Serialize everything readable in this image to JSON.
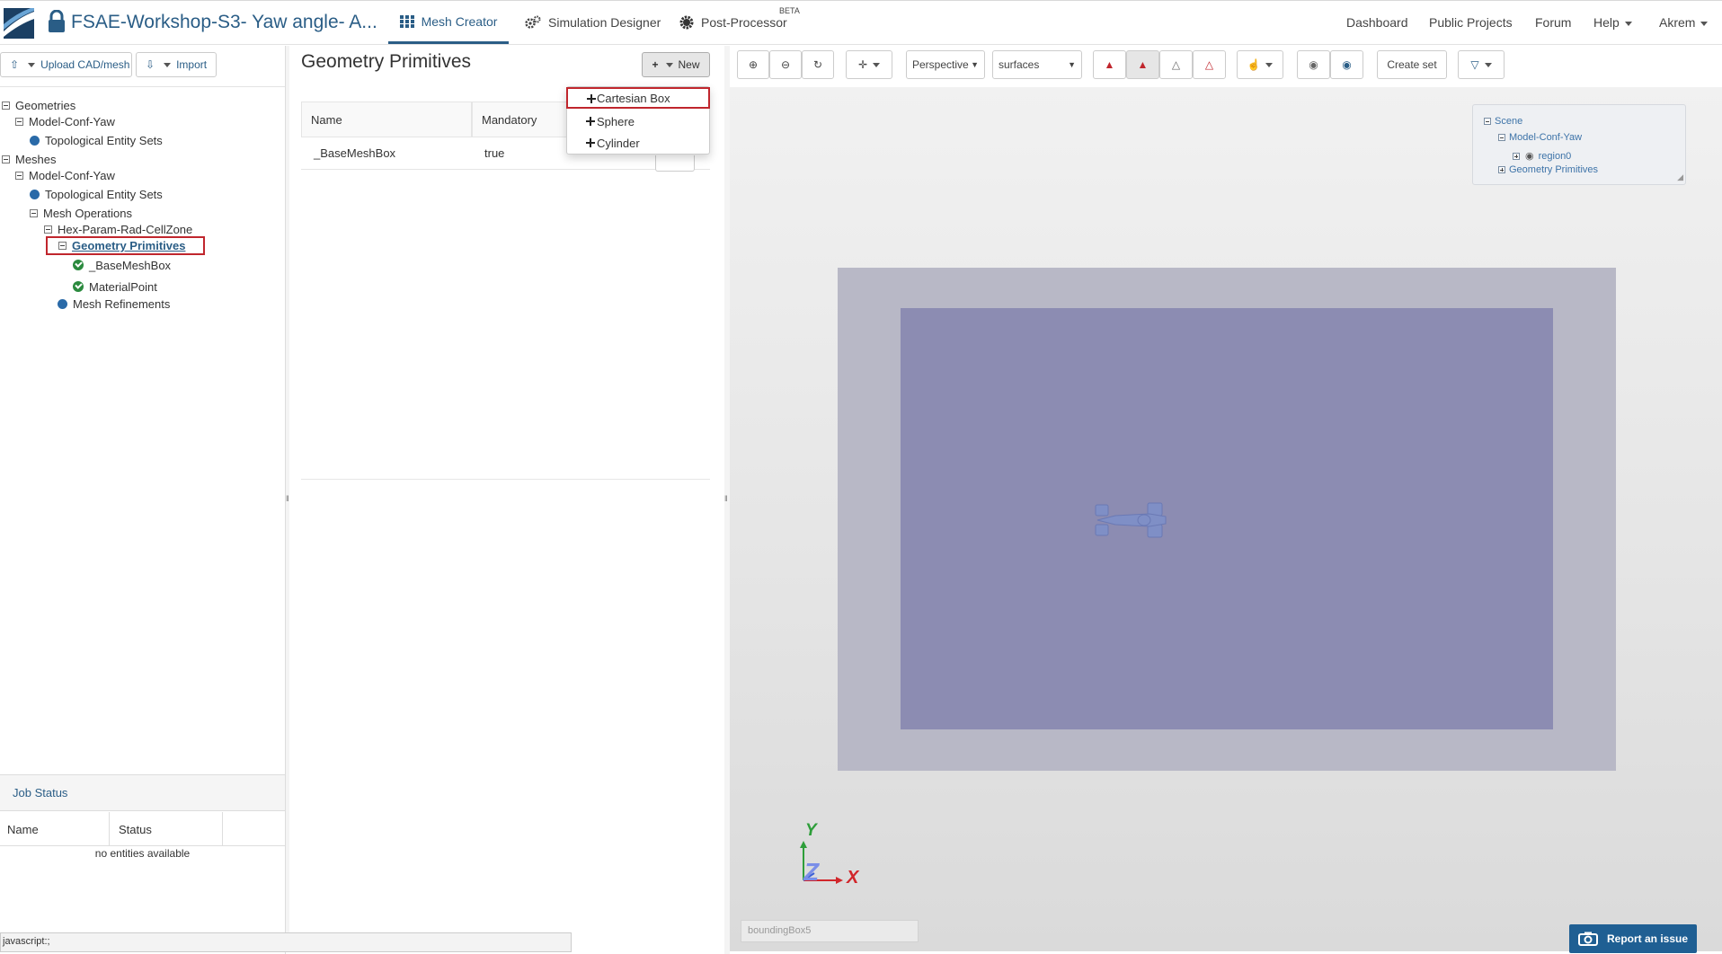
{
  "header": {
    "project_title": "FSAE-Workshop-S3- Yaw angle- A...",
    "tabs": [
      {
        "label": "Mesh Creator",
        "active": true
      },
      {
        "label": "Simulation Designer",
        "active": false
      },
      {
        "label": "Post-Processor",
        "active": false
      }
    ],
    "beta_badge": "BETA",
    "right_links": [
      "Dashboard",
      "Public Projects",
      "Forum",
      "Help",
      "Akrem"
    ]
  },
  "left_panel": {
    "upload_button": "Upload CAD/mesh",
    "import_button": "Import",
    "tree": [
      {
        "label": "Geometries"
      },
      {
        "label": "Model-Conf-Yaw"
      },
      {
        "label": "Topological Entity Sets"
      },
      {
        "label": "Meshes"
      },
      {
        "label": "Model-Conf-Yaw"
      },
      {
        "label": "Topological Entity Sets"
      },
      {
        "label": "Mesh Operations"
      },
      {
        "label": "Hex-Param-Rad-CellZone"
      },
      {
        "label": "Geometry Primitives",
        "selected": true
      },
      {
        "label": "_BaseMeshBox"
      },
      {
        "label": "MaterialPoint"
      },
      {
        "label": "Mesh Refinements"
      }
    ],
    "job_status": {
      "title": "Job Status",
      "columns": [
        "Name",
        "Status"
      ],
      "empty_text": "no entities available"
    },
    "status_bar_text": "javascript:;"
  },
  "middle_panel": {
    "title": "Geometry Primitives",
    "new_button": "New",
    "table": {
      "columns": [
        "Name",
        "Mandatory"
      ],
      "rows": [
        {
          "name": "_BaseMeshBox",
          "mandatory": "true"
        }
      ]
    },
    "new_menu": [
      "Cartesian Box",
      "Sphere",
      "Cylinder"
    ],
    "highlighted_menu_item": "Cartesian Box"
  },
  "viewer": {
    "projection": "Perspective",
    "render_mode": "surfaces",
    "create_set_button": "Create set",
    "scene_tree": [
      "Scene",
      "Model-Conf-Yaw",
      "region0",
      "Geometry Primitives"
    ],
    "axis_labels": {
      "y": "Y",
      "z": "Z",
      "x": "X"
    },
    "bounding_box_field": "boundingBox5",
    "report_button": "Report an issue",
    "colors": {
      "outer_box": "#b8b8c6",
      "inner_box": "#8c8cb2",
      "accent": "#2a5d86",
      "highlight": "#c0262d"
    }
  }
}
